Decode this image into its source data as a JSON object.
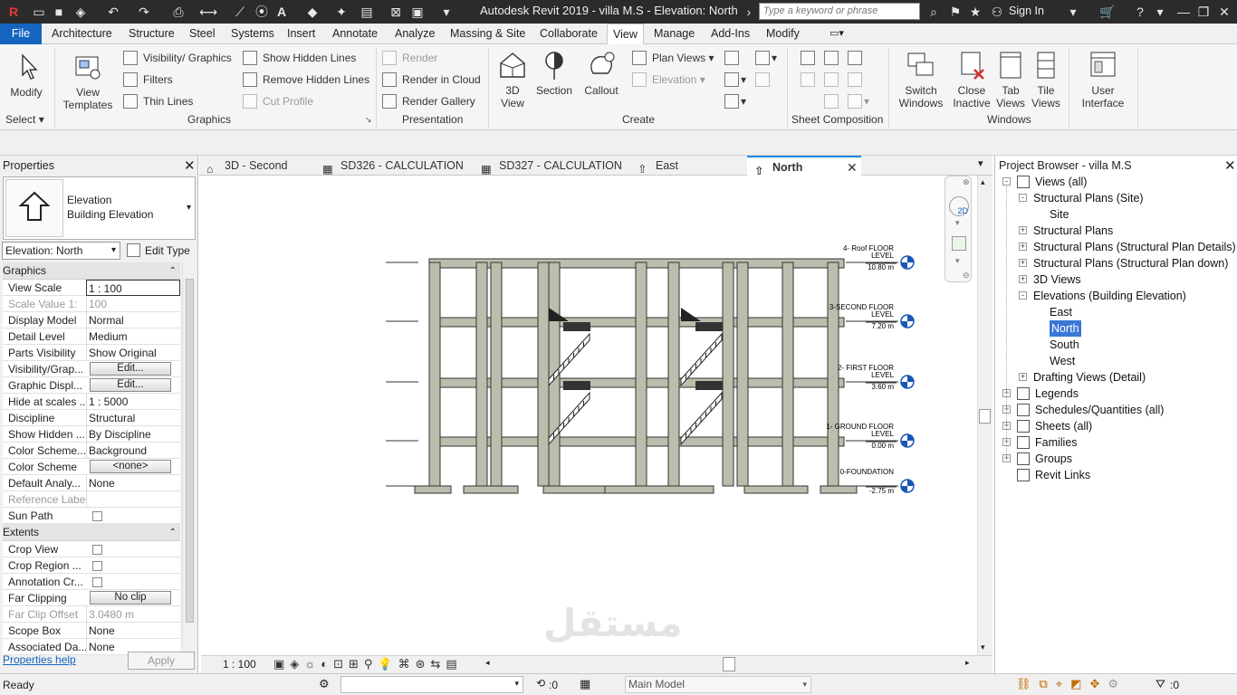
{
  "app": {
    "window_title": "Autodesk Revit 2019 - villa M.S - Elevation: North",
    "search_placeholder": "Type a keyword or phrase",
    "sign_in": "Sign In"
  },
  "menu": [
    "File",
    "Architecture",
    "Structure",
    "Steel",
    "Systems",
    "Insert",
    "Annotate",
    "Analyze",
    "Massing & Site",
    "Collaborate",
    "View",
    "Manage",
    "Add-Ins",
    "Modify"
  ],
  "ribbon": {
    "modify": "Modify",
    "select": "Select",
    "view_templates": [
      "View",
      "Templates"
    ],
    "graphics": {
      "visibility": "Visibility/ Graphics",
      "filters": "Filters",
      "thin_lines": "Thin  Lines",
      "show_hidden": "Show  Hidden  Lines",
      "remove_hidden": "Remove  Hidden  Lines",
      "cut_profile": "Cut  Profile",
      "title": "Graphics"
    },
    "presentation": {
      "render": "Render",
      "render_cloud": "Render  in Cloud",
      "render_gallery": "Render  Gallery",
      "title": "Presentation"
    },
    "create": {
      "view3d": [
        "3D",
        "View"
      ],
      "section": "Section",
      "callout": "Callout",
      "plan_views": "Plan  Views",
      "elevation": "Elevation",
      "title": "Create"
    },
    "sheet_title": "Sheet Composition",
    "windows": {
      "switch": [
        "Switch",
        "Windows"
      ],
      "close_inactive": [
        "Close",
        "Inactive"
      ],
      "tab_views": [
        "Tab",
        "Views"
      ],
      "tile_views": [
        "Tile",
        "Views"
      ],
      "title": "Windows"
    },
    "user_interface": [
      "User",
      "Interface"
    ]
  },
  "properties": {
    "title": "Properties",
    "type_name": [
      "Elevation",
      "Building Elevation"
    ],
    "instance_selector": "Elevation: North",
    "edit_type": "Edit Type",
    "groups": [
      {
        "name": "Graphics",
        "rows": [
          {
            "k": "View Scale",
            "v": "1 : 100",
            "kind": "input"
          },
          {
            "k": "Scale Value    1:",
            "v": "100",
            "kind": "ro"
          },
          {
            "k": "Display Model",
            "v": "Normal"
          },
          {
            "k": "Detail Level",
            "v": "Medium"
          },
          {
            "k": "Parts Visibility",
            "v": "Show Original"
          },
          {
            "k": "Visibility/Grap...",
            "v": "Edit...",
            "kind": "button"
          },
          {
            "k": "Graphic Displ...",
            "v": "Edit...",
            "kind": "button"
          },
          {
            "k": "Hide at scales ...",
            "v": "1 : 5000"
          },
          {
            "k": "Discipline",
            "v": "Structural"
          },
          {
            "k": "Show Hidden ...",
            "v": "By Discipline"
          },
          {
            "k": "Color Scheme...",
            "v": "Background"
          },
          {
            "k": "Color Scheme",
            "v": "<none>",
            "kind": "button"
          },
          {
            "k": "Default Analy...",
            "v": "None"
          },
          {
            "k": "Reference Label",
            "v": "",
            "kind": "ro"
          },
          {
            "k": "Sun Path",
            "v": "",
            "kind": "check"
          }
        ]
      },
      {
        "name": "Extents",
        "rows": [
          {
            "k": "Crop View",
            "v": "",
            "kind": "check"
          },
          {
            "k": "Crop Region ...",
            "v": "",
            "kind": "check"
          },
          {
            "k": "Annotation Cr...",
            "v": "",
            "kind": "check"
          },
          {
            "k": "Far Clipping",
            "v": "No clip",
            "kind": "button"
          },
          {
            "k": "Far Clip Offset",
            "v": "3.0480 m",
            "kind": "ro"
          },
          {
            "k": "Scope Box",
            "v": "None"
          },
          {
            "k": "Associated Da...",
            "v": "None"
          }
        ]
      }
    ],
    "help_link": "Properties help",
    "apply": "Apply"
  },
  "tabs": [
    "3D - Second",
    "SD326 - CALCULATION",
    "SD327 - CALCULATION",
    "East",
    "North"
  ],
  "levels": [
    {
      "name": "4- Roof FLOOR",
      "sub": "LEVEL",
      "elev": "10.80 m"
    },
    {
      "name": "3-SECOND FLOOR",
      "sub": "LEVEL",
      "elev": "7.20 m"
    },
    {
      "name": "2- FIRST FLOOR",
      "sub": "LEVEL",
      "elev": "3.60 m"
    },
    {
      "name": "1- GROUND FLOOR",
      "sub": "LEVEL",
      "elev": "0.00 m"
    },
    {
      "name": "0-FOUNDATION",
      "sub": "",
      "elev": "-2.75 m"
    }
  ],
  "view_control": {
    "scale": "1 : 100"
  },
  "browser": {
    "title": "Project Browser - villa M.S",
    "nodes": [
      {
        "label": "Views (all)",
        "depth": 0,
        "exp": "-",
        "icon": true
      },
      {
        "label": "Structural Plans (Site)",
        "depth": 1,
        "exp": "-"
      },
      {
        "label": "Site",
        "depth": 2
      },
      {
        "label": "Structural Plans",
        "depth": 1,
        "exp": "+"
      },
      {
        "label": "Structural Plans (Structural Plan Details)",
        "depth": 1,
        "exp": "+"
      },
      {
        "label": "Structural Plans (Structural Plan down)",
        "depth": 1,
        "exp": "+"
      },
      {
        "label": "3D Views",
        "depth": 1,
        "exp": "+"
      },
      {
        "label": "Elevations (Building Elevation)",
        "depth": 1,
        "exp": "-"
      },
      {
        "label": "East",
        "depth": 2
      },
      {
        "label": "North",
        "depth": 2,
        "selected": true
      },
      {
        "label": "South",
        "depth": 2
      },
      {
        "label": "West",
        "depth": 2
      },
      {
        "label": "Drafting Views (Detail)",
        "depth": 1,
        "exp": "+"
      },
      {
        "label": "Legends",
        "depth": 0,
        "exp": "+",
        "icon": true
      },
      {
        "label": "Schedules/Quantities (all)",
        "depth": 0,
        "exp": "+",
        "icon": true
      },
      {
        "label": "Sheets (all)",
        "depth": 0,
        "exp": "+",
        "icon": true
      },
      {
        "label": "Families",
        "depth": 0,
        "exp": "+",
        "icon": true
      },
      {
        "label": "Groups",
        "depth": 0,
        "exp": "+",
        "icon": true
      },
      {
        "label": "Revit Links",
        "depth": 0,
        "icon": true
      }
    ]
  },
  "status": {
    "ready": "Ready",
    "count": ":0",
    "model": "Main Model",
    "filter_count": ":0"
  },
  "colors": {
    "file_tab": "#1565c0",
    "title_bar": "#2b2b2b",
    "selected_node": "#3a78d6",
    "level_head": "#1a56b5"
  }
}
